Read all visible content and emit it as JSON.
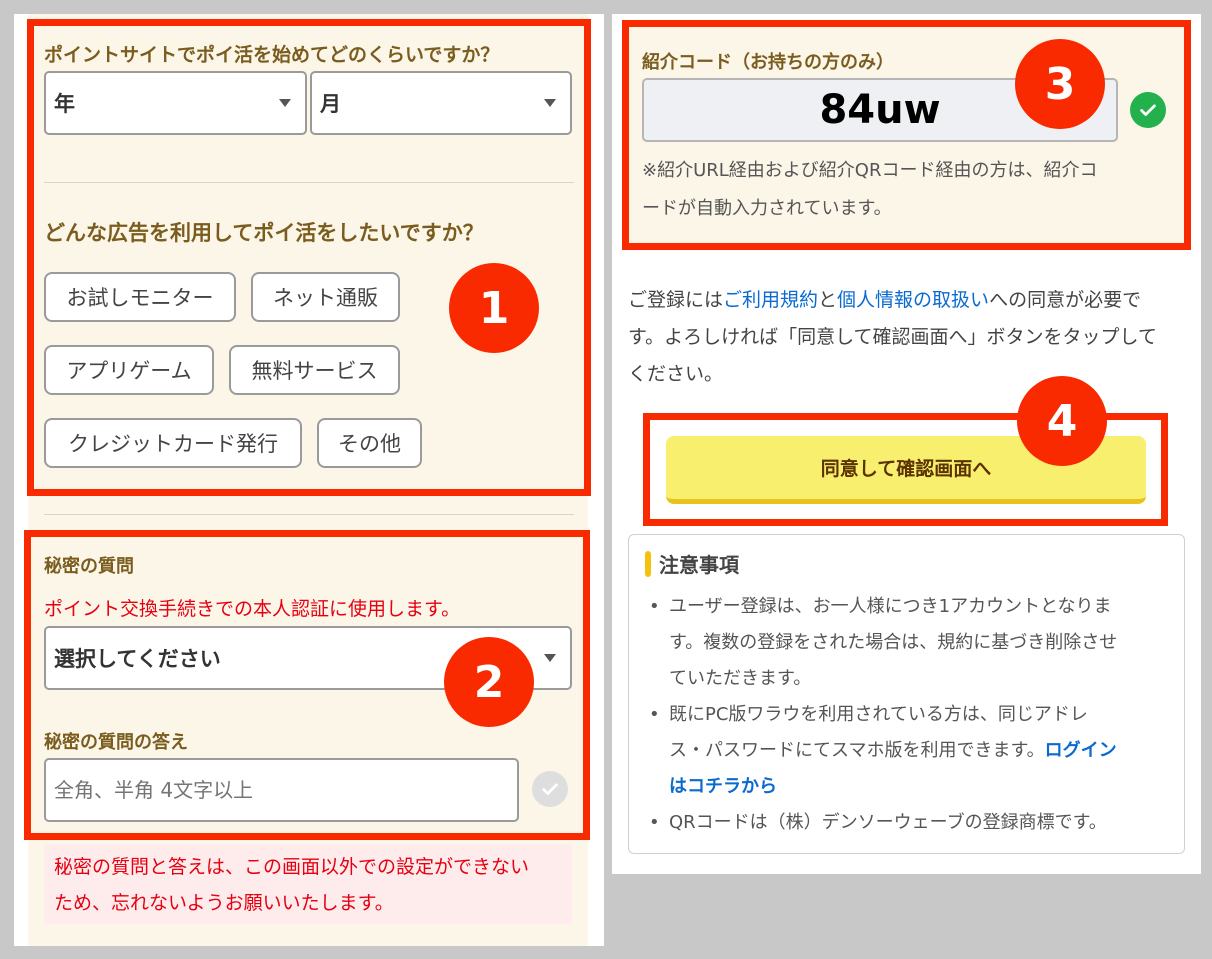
{
  "form": {
    "start_question": "ポイントサイトでポイ活を始めてどのくらいですか？",
    "year_select": "年",
    "month_select": "月",
    "ad_question": "どんな広告を利用してポイ活をしたいですか？",
    "ad_options": [
      "お試しモニター",
      "ネット通販",
      "アプリゲーム",
      "無料サービス",
      "クレジットカード発行",
      "その他"
    ],
    "secret_title": "秘密の質問",
    "secret_note": "ポイント交換手続きでの本人認証に使用します。",
    "secret_select": "選択してください",
    "answer_title": "秘密の質問の答え",
    "answer_placeholder": "全角、半角 4文字以上",
    "warning_line1": "秘密の質問と答えは、この画面以外での設定ができない",
    "warning_line2": "ため、忘れないようお願いいたします。"
  },
  "referral": {
    "label": "紹介コード（お持ちの方のみ）",
    "code": "84uw",
    "note_line1": "※紹介URL経由および紹介QRコード経由の方は、紹介コ",
    "note_line2": "ードが自動入力されています。"
  },
  "agreement": {
    "prefix": "ご登録には",
    "terms_link": "ご利用規約",
    "and": "と",
    "privacy_link": "個人情報の取扱い",
    "suffix_line1": "への同意が必要で",
    "line2": "す。よろしければ「同意して確認画面へ」ボタンをタップして",
    "line3": "ください。"
  },
  "submit_button": "同意して確認画面へ",
  "notes": {
    "title": "注意事項",
    "item1": [
      "ユーザー登録は、お一人様につき1アカウントとなりま",
      "す。複数の登録をされた場合は、規約に基づき削除させ",
      "ていただきます。"
    ],
    "item2_line1": "既にPC版ワラウを利用されている方は、同じアドレ",
    "item2_line2": "ス・パスワードにてスマホ版を利用できます。",
    "item2_link1": "ログイン",
    "item2_link2": "はコチラから",
    "item3": "QRコードは（株）デンソーウェーブの登録商標です。"
  },
  "badges": [
    "1",
    "2",
    "3",
    "4"
  ],
  "colors": {
    "annotation_red": "#fa2a00",
    "form_bg": "#fbf6e8",
    "label_brown": "#7a5c1e",
    "link_blue": "#0a6ad0",
    "button_yellow": "#f9ef6e",
    "check_green": "#22b14c"
  }
}
